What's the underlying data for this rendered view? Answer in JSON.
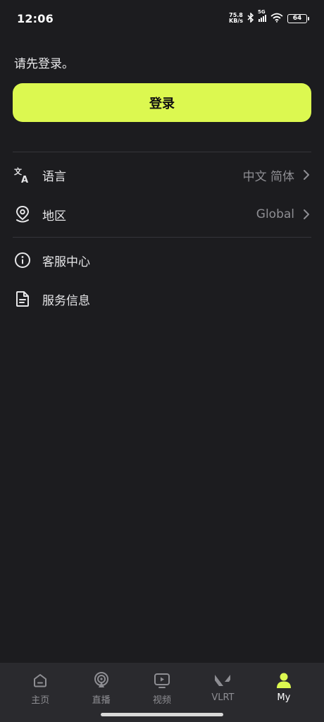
{
  "status_bar": {
    "time": "12:06",
    "net_speed_value": "75.8",
    "net_speed_unit": "KB/s",
    "network_type": "5G",
    "battery": "64"
  },
  "login": {
    "prompt": "请先登录。",
    "button_label": "登录",
    "button_color": "#dcf850"
  },
  "settings": {
    "language_label": "语言",
    "language_value": "中文 简体",
    "region_label": "地区",
    "region_value": "Global",
    "support_label": "客服中心",
    "service_info_label": "服务信息"
  },
  "bottom_nav": {
    "items": [
      {
        "label": "主页",
        "icon": "home-icon"
      },
      {
        "label": "直播",
        "icon": "broadcast-icon"
      },
      {
        "label": "视频",
        "icon": "video-icon"
      },
      {
        "label": "VLRT",
        "icon": "valorant-icon"
      },
      {
        "label": "My",
        "icon": "user-icon",
        "active": true
      }
    ],
    "active_color": "#dcf850"
  }
}
